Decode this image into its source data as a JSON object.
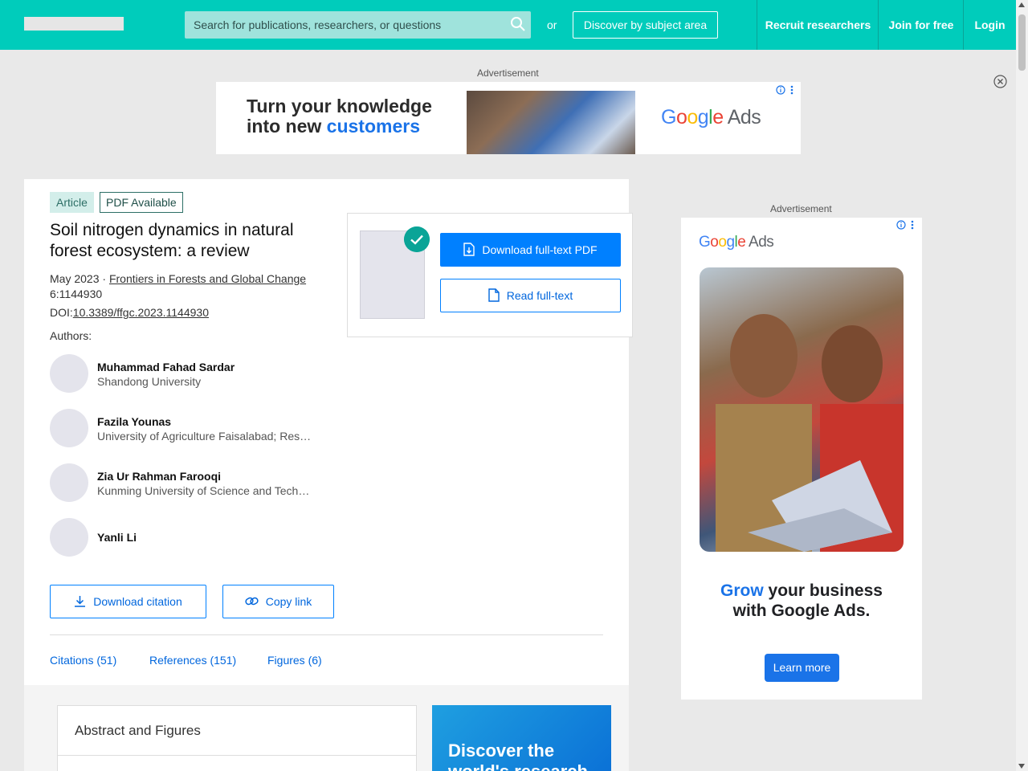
{
  "header": {
    "search_placeholder": "Search for publications, researchers, or questions",
    "or_text": "or",
    "discover_label": "Discover by subject area",
    "nav": {
      "recruit": "Recruit researchers",
      "join": "Join for free",
      "login": "Login"
    }
  },
  "ads": {
    "label": "Advertisement",
    "top": {
      "headline_line1": "Turn your knowledge",
      "headline_line2_prefix": "into new ",
      "headline_line2_highlight": "customers",
      "brand": "Google Ads"
    },
    "side": {
      "brand": "Google Ads",
      "headline_highlight": "Grow",
      "headline_rest": " your business",
      "headline_line2": "with Google Ads.",
      "cta": "Learn more"
    }
  },
  "article": {
    "tags": [
      "Article",
      "PDF Available"
    ],
    "title": "Soil nitrogen dynamics in natural forest ecosystem: a review",
    "date": "May 2023",
    "separator": " · ",
    "journal": "Frontiers in Forests and Global Change",
    "volume": "6:1144930",
    "doi_label": "DOI:",
    "doi": "10.3389/ffgc.2023.1144930",
    "authors_label": "Authors:",
    "authors": [
      {
        "name": "Muhammad Fahad Sardar",
        "institution": "Shandong University"
      },
      {
        "name": "Fazila Younas",
        "institution": "University of Agriculture Faisalabad; Research"
      },
      {
        "name": "Zia Ur Rahman Farooqi",
        "institution": "Kunming University of Science and Technology"
      },
      {
        "name": "Yanli Li",
        "institution": ""
      }
    ],
    "download_pdf": "Download full-text PDF",
    "read_fulltext": "Read full-text",
    "download_citation": "Download citation",
    "copy_link": "Copy link",
    "tabs": [
      "Citations (51)",
      "References (151)",
      "Figures (6)"
    ],
    "abstract_title": "Abstract and Figures",
    "discover_promo": "Discover the world's research"
  }
}
